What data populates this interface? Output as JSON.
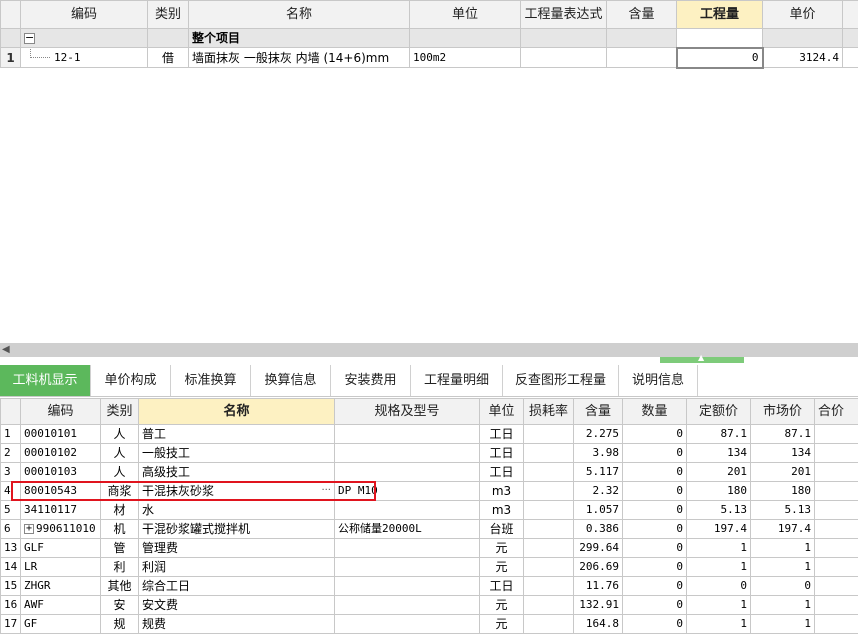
{
  "top": {
    "columns": [
      "编码",
      "类别",
      "名称",
      "单位",
      "工程量表达式",
      "含量",
      "工程量",
      "单价"
    ],
    "group_row": {
      "toggle": "−",
      "name": "整个项目"
    },
    "rows": [
      {
        "num": "1",
        "code": "12-1",
        "type": "借",
        "name": "墙面抹灰 一般抹灰 内墙 (14+6)mm",
        "unit": "100m2",
        "expr": "",
        "content": "",
        "qty": "0",
        "price": "3124.4"
      }
    ]
  },
  "tabs": [
    "工料机显示",
    "单价构成",
    "标准换算",
    "换算信息",
    "安装费用",
    "工程量明细",
    "反查图形工程量",
    "说明信息"
  ],
  "bottom": {
    "columns": [
      "",
      "编码",
      "类别",
      "名称",
      "规格及型号",
      "单位",
      "损耗率",
      "含量",
      "数量",
      "定额价",
      "市场价",
      "合价"
    ],
    "rows": [
      {
        "n": "1",
        "code": "00010101",
        "type": "人",
        "name": "普工",
        "spec": "",
        "unit": "工日",
        "loss": "",
        "content": "2.275",
        "qty": "0",
        "quota": "87.1",
        "market": "87.1",
        "expand": ""
      },
      {
        "n": "2",
        "code": "00010102",
        "type": "人",
        "name": "一般技工",
        "spec": "",
        "unit": "工日",
        "loss": "",
        "content": "3.98",
        "qty": "0",
        "quota": "134",
        "market": "134",
        "expand": ""
      },
      {
        "n": "3",
        "code": "00010103",
        "type": "人",
        "name": "高级技工",
        "spec": "",
        "unit": "工日",
        "loss": "",
        "content": "5.117",
        "qty": "0",
        "quota": "201",
        "market": "201",
        "expand": ""
      },
      {
        "n": "4",
        "code": "80010543",
        "type": "商浆",
        "name": "干混抹灰砂浆",
        "spec": "DP M10",
        "unit": "m3",
        "loss": "",
        "content": "2.32",
        "qty": "0",
        "quota": "180",
        "market": "180",
        "expand": ""
      },
      {
        "n": "5",
        "code": "34110117",
        "type": "材",
        "name": "水",
        "spec": "",
        "unit": "m3",
        "loss": "",
        "content": "1.057",
        "qty": "0",
        "quota": "5.13",
        "market": "5.13",
        "expand": ""
      },
      {
        "n": "6",
        "code": "990611010",
        "type": "机",
        "name": "干混砂浆罐式搅拌机",
        "spec": "公称储量20000L",
        "unit": "台班",
        "loss": "",
        "content": "0.386",
        "qty": "0",
        "quota": "197.4",
        "market": "197.4",
        "expand": "+"
      },
      {
        "n": "13",
        "code": "GLF",
        "type": "管",
        "name": "管理费",
        "spec": "",
        "unit": "元",
        "loss": "",
        "content": "299.64",
        "qty": "0",
        "quota": "1",
        "market": "1",
        "expand": ""
      },
      {
        "n": "14",
        "code": "LR",
        "type": "利",
        "name": "利润",
        "spec": "",
        "unit": "元",
        "loss": "",
        "content": "206.69",
        "qty": "0",
        "quota": "1",
        "market": "1",
        "expand": ""
      },
      {
        "n": "15",
        "code": "ZHGR",
        "type": "其他",
        "name": "综合工日",
        "spec": "",
        "unit": "工日",
        "loss": "",
        "content": "11.76",
        "qty": "0",
        "quota": "0",
        "market": "0",
        "expand": ""
      },
      {
        "n": "16",
        "code": "AWF",
        "type": "安",
        "name": "安文费",
        "spec": "",
        "unit": "元",
        "loss": "",
        "content": "132.91",
        "qty": "0",
        "quota": "1",
        "market": "1",
        "expand": ""
      },
      {
        "n": "17",
        "code": "GF",
        "type": "规",
        "name": "规费",
        "spec": "",
        "unit": "元",
        "loss": "",
        "content": "164.8",
        "qty": "0",
        "quota": "1",
        "market": "1",
        "expand": ""
      }
    ],
    "ellipsis": "···"
  },
  "colors": {
    "active_tab": "#5cb85c",
    "selected_header": "#fdf1c2",
    "highlight_border": "#e0141e"
  }
}
